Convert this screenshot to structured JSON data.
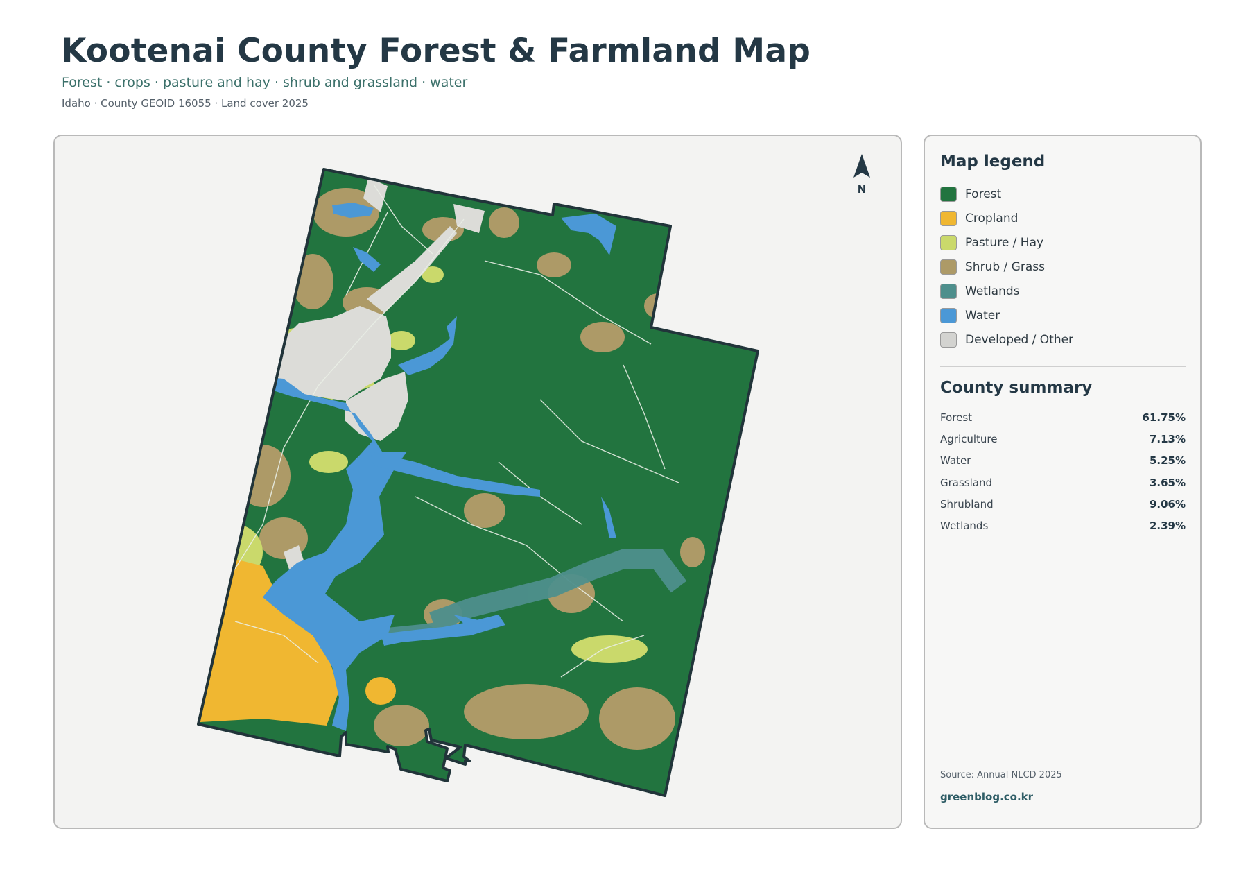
{
  "header": {
    "title": "Kootenai County Forest & Farmland Map",
    "subtitle": "Forest · crops · pasture and hay · shrub and grassland · water",
    "meta": "Idaho · County GEOID 16055 · Land cover 2025"
  },
  "map": {
    "north_label": "N",
    "colors": {
      "forest": "#22743f",
      "cropland": "#f0b731",
      "pasture": "#cad96b",
      "shrub": "#ad9a67",
      "wetlands": "#4e8f8c",
      "water": "#4b98d6",
      "developed": "#dcdcd8",
      "boundary": "#21343a"
    }
  },
  "legend": {
    "heading": "Map legend",
    "items": [
      {
        "label": "Forest",
        "color": "#22743f"
      },
      {
        "label": "Cropland",
        "color": "#f0b731"
      },
      {
        "label": "Pasture / Hay",
        "color": "#cad96b"
      },
      {
        "label": "Shrub / Grass",
        "color": "#ad9a67"
      },
      {
        "label": "Wetlands",
        "color": "#4e8f8c"
      },
      {
        "label": "Water",
        "color": "#4b98d6"
      },
      {
        "label": "Developed / Other",
        "color": "#d3d3d0"
      }
    ]
  },
  "summary": {
    "heading": "County summary",
    "rows": [
      {
        "name": "Forest",
        "value": "61.75%"
      },
      {
        "name": "Agriculture",
        "value": "7.13%"
      },
      {
        "name": "Water",
        "value": "5.25%"
      },
      {
        "name": "Grassland",
        "value": "3.65%"
      },
      {
        "name": "Shrubland",
        "value": "9.06%"
      },
      {
        "name": "Wetlands",
        "value": "2.39%"
      }
    ]
  },
  "footer": {
    "source": "Source: Annual NLCD 2025",
    "site": "greenblog.co.kr"
  }
}
